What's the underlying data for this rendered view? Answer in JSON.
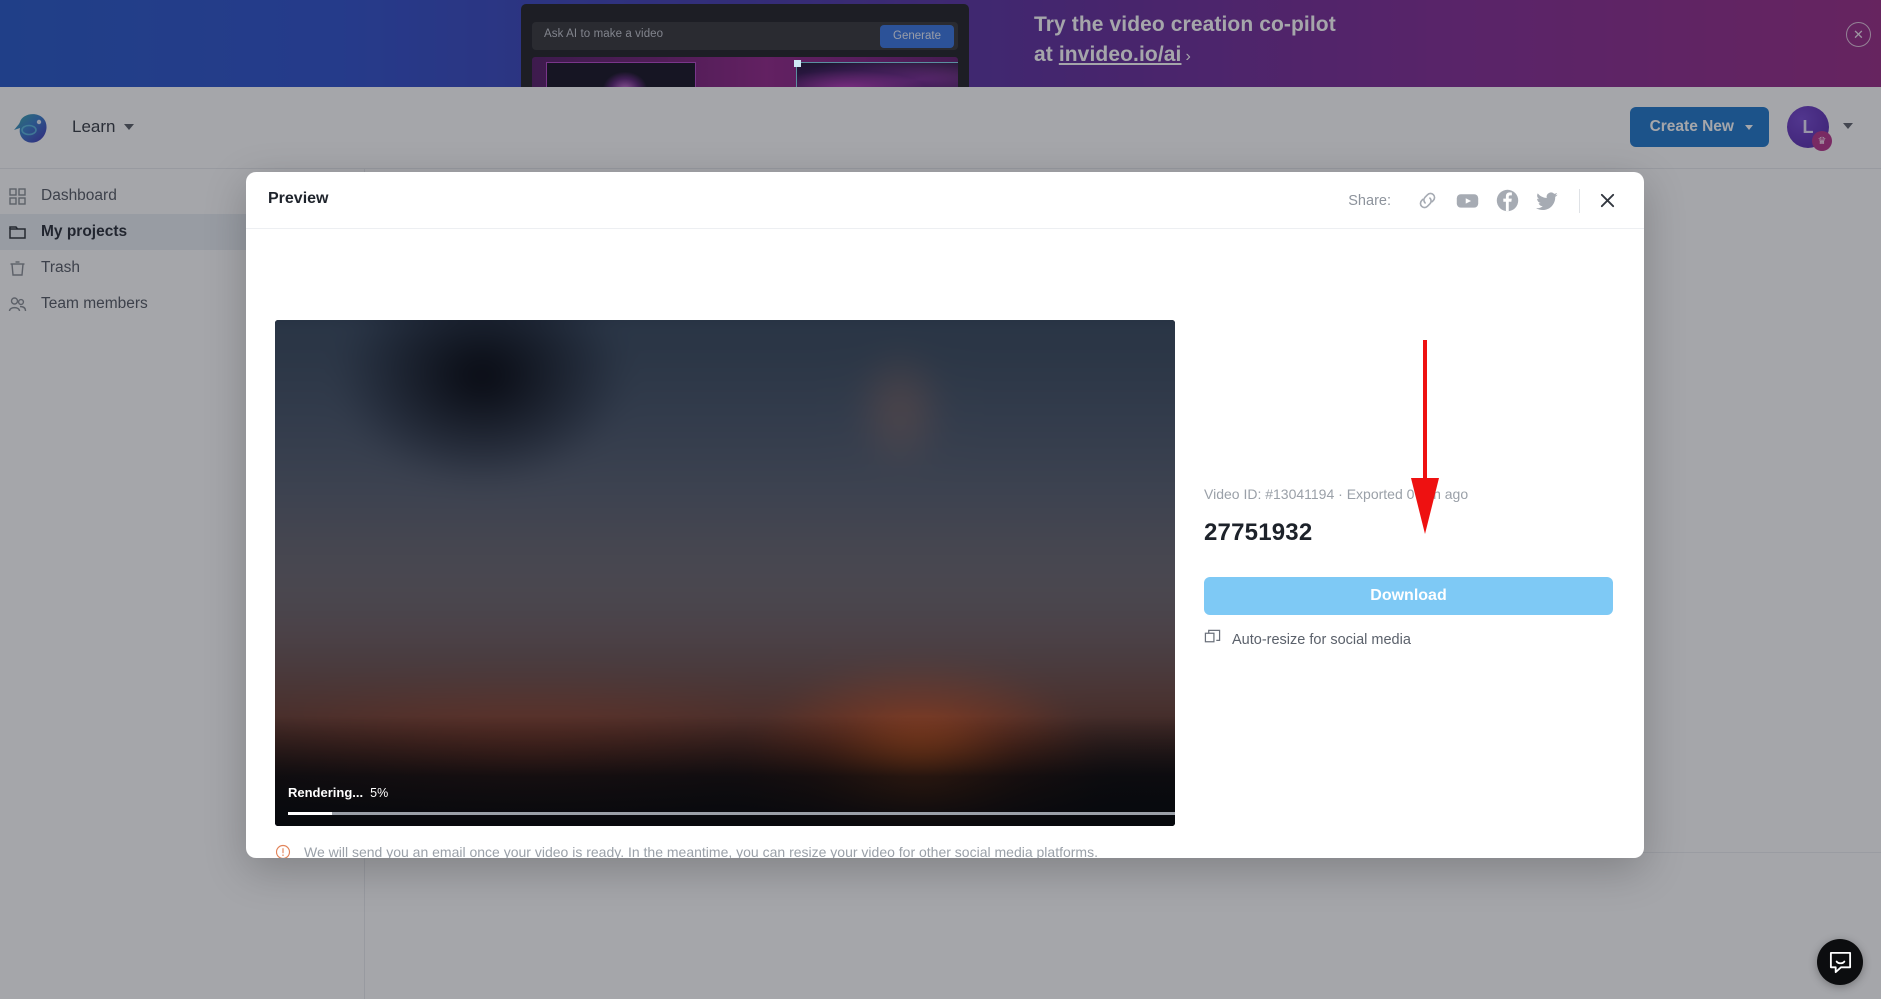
{
  "promo": {
    "prompt_placeholder": "Ask AI to make a video",
    "generate_label": "Generate",
    "headline_line1": "Try the video creation co-pilot",
    "headline_prefix": "at",
    "link_text": "invideo.io/ai",
    "chevron": "›",
    "close_icon": "close-circle-icon"
  },
  "topnav": {
    "brand": "invideo-logo",
    "learn_label": "Learn",
    "create_new_label": "Create New",
    "avatar_initial": "L",
    "avatar_badge_icon": "crown-icon"
  },
  "sidebar": {
    "items": [
      {
        "label": "Dashboard",
        "icon": "grid-icon",
        "active": false
      },
      {
        "label": "My projects",
        "icon": "folder-icon",
        "active": true
      },
      {
        "label": "Trash",
        "icon": "trash-icon",
        "active": false
      },
      {
        "label": "Team members",
        "icon": "users-icon",
        "active": false
      }
    ]
  },
  "modal": {
    "title": "Preview",
    "share_label": "Share:",
    "share_buttons": [
      {
        "name": "copy-link",
        "icon": "link-icon"
      },
      {
        "name": "youtube",
        "icon": "youtube-icon"
      },
      {
        "name": "facebook",
        "icon": "facebook-icon"
      },
      {
        "name": "twitter",
        "icon": "twitter-icon"
      }
    ],
    "close_icon": "close-icon",
    "video": {
      "render_label": "Rendering...",
      "render_percent": "5%",
      "progress_value": 5
    },
    "details": {
      "meta": "Video ID: #13041194 · Exported 0 min ago",
      "video_id": "#13041194",
      "exported_text": "Exported 0 min ago",
      "title": "27751932",
      "download_label": "Download",
      "auto_resize_label": "Auto-resize for social media",
      "auto_resize_icon": "copy-frames-icon"
    },
    "note": "We will send you an email once your video is ready. In the meantime, you can resize your video for other social media platforms.",
    "note_icon": "info-circle-icon"
  },
  "annotation": {
    "arrow_color": "#ee1111",
    "arrow_name": "red-down-arrow"
  },
  "widgets": {
    "chat_icon": "intercom-chat-icon"
  },
  "colors": {
    "accent_blue": "#1371c8",
    "download_blue": "#7ec9f5",
    "sidebar_active_bg": "#e9eef3",
    "annotation_red": "#ee1111"
  }
}
